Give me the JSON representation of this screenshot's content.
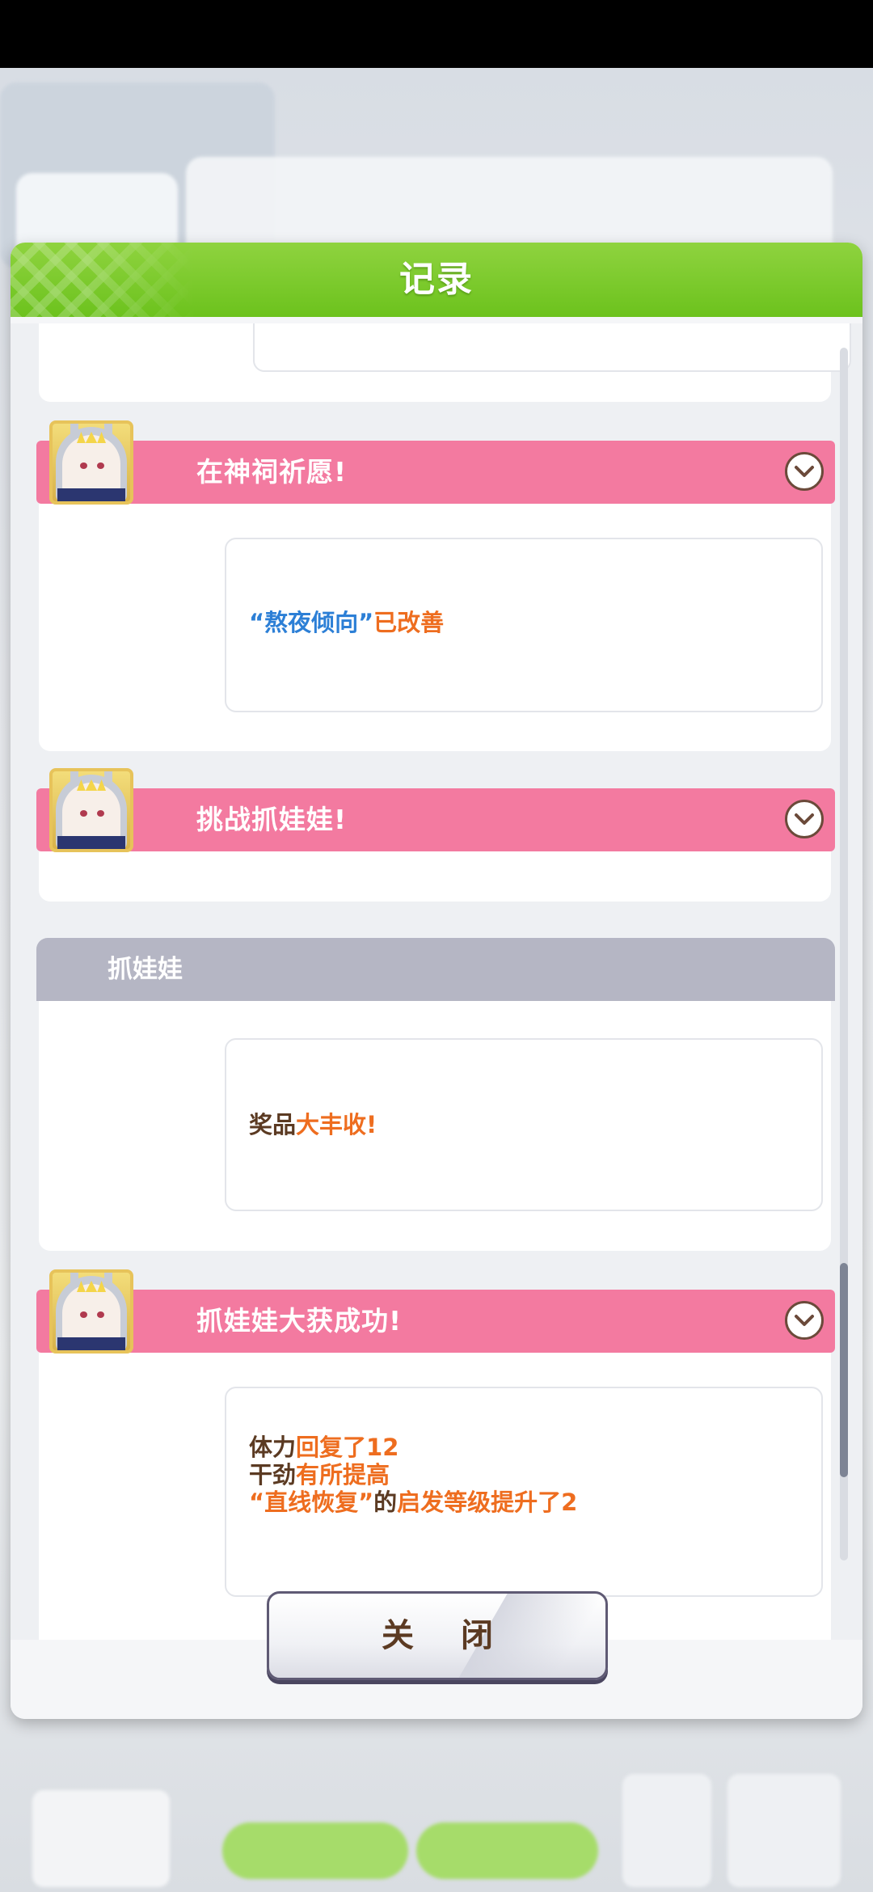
{
  "dialog": {
    "title": "记录",
    "close_label": "关 闭"
  },
  "entries": [
    {
      "title": "在神祠祈愿!",
      "message": {
        "quote_open": "“",
        "skill": "熬夜倾向",
        "quote_close": "”",
        "result": "已改善"
      }
    },
    {
      "title": "挑战抓娃娃!"
    },
    {
      "section_title": "抓娃娃",
      "message": {
        "prefix": "奖品",
        "highlight": "大丰收!"
      }
    },
    {
      "title": "抓娃娃大获成功!",
      "message": {
        "line1_label": "体力",
        "line1_value": "回复了12",
        "line2_label": "干劲",
        "line2_value": "有所提高",
        "line3_quote_open": "“",
        "line3_skill": "直线恢复",
        "line3_quote_close": "”",
        "line3_mid": "的",
        "line3_value": "启发等级提升了2"
      }
    }
  ],
  "colors": {
    "header_green": "#7bc92c",
    "event_pink": "#f37aa0",
    "section_gray": "#b5b6c4",
    "highlight_orange": "#ee6d1f",
    "skill_blue": "#2c7fd6",
    "text_brown": "#5b3a22"
  },
  "icons": {
    "expand": "chevron-down-icon",
    "avatar": "character-portrait"
  }
}
